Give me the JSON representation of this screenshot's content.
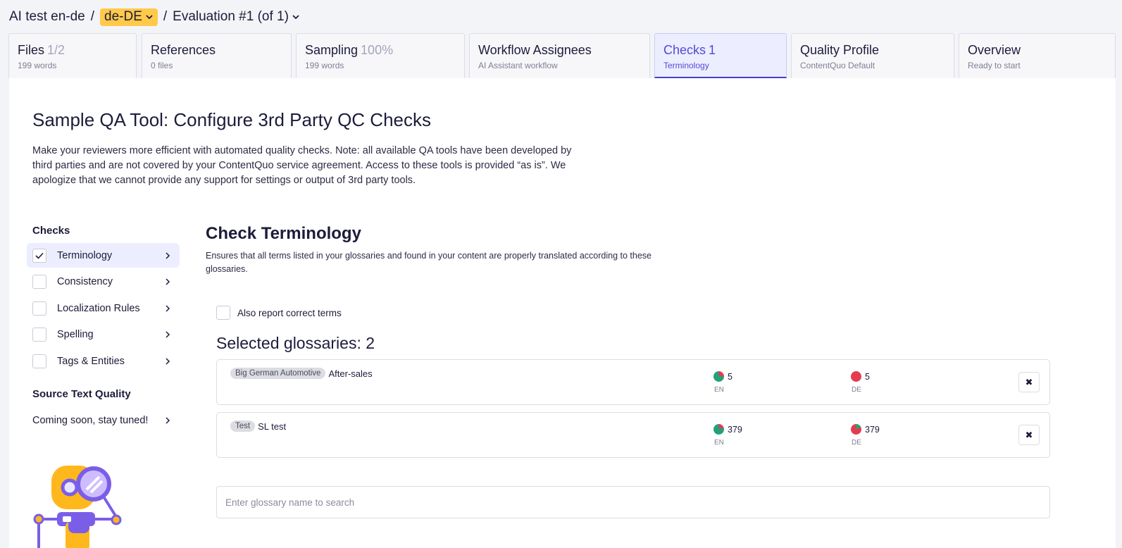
{
  "breadcrumb": {
    "project": "AI test en-de",
    "separator": "/",
    "language": "de-DE",
    "evaluation": "Evaluation #1 (of 1)"
  },
  "tabs": [
    {
      "title": "Files",
      "extra": "1/2",
      "sub": "199 words"
    },
    {
      "title": "References",
      "extra": "",
      "sub": "0 files"
    },
    {
      "title": "Sampling",
      "extra": "100%",
      "sub": "199 words"
    },
    {
      "title": "Workflow Assignees",
      "extra": "",
      "sub": "AI Assistant workflow"
    },
    {
      "title": "Checks",
      "extra": "1",
      "sub": "Terminology",
      "active": true
    },
    {
      "title": "Quality Profile",
      "extra": "",
      "sub": "ContentQuo Default"
    },
    {
      "title": "Overview",
      "extra": "",
      "sub": "Ready to start"
    }
  ],
  "page": {
    "title": "Sample QA Tool: Configure 3rd Party QC Checks",
    "description": "Make your reviewers more efficient with automated quality checks. Note: all available QA tools have been developed by third parties and are not covered by your ContentQuo service agreement. Access to these tools is provided “as is”. We apologize that we cannot provide any support for settings or output of 3rd party tools."
  },
  "checks": {
    "heading": "Checks",
    "items": [
      {
        "label": "Terminology",
        "checked": true
      },
      {
        "label": "Consistency",
        "checked": false
      },
      {
        "label": "Localization Rules",
        "checked": false
      },
      {
        "label": "Spelling",
        "checked": false
      },
      {
        "label": "Tags & Entities",
        "checked": false
      }
    ]
  },
  "source_quality": {
    "heading": "Source Text Quality",
    "item": "Coming soon, stay tuned!"
  },
  "terminology": {
    "title": "Check Terminology",
    "description": "Ensures that all terms listed in your glossaries and found in your content are properly translated according to these glossaries.",
    "also_report_label": "Also report correct terms",
    "selected_heading": "Selected glossaries: 2",
    "glossaries": [
      {
        "badge": "Big German Automotive",
        "name": "After-sales",
        "en_count": "5",
        "en_code": "EN",
        "de_count": "5",
        "de_code": "DE",
        "remove": "✖"
      },
      {
        "badge": "Test",
        "name": "SL test",
        "en_count": "379",
        "en_code": "EN",
        "de_count": "379",
        "de_code": "DE",
        "remove": "✖"
      }
    ],
    "search_placeholder": "Enter glossary name to search"
  },
  "colors": {
    "accent": "#5548d4",
    "highlight": "#ffc94a",
    "pie_green": "#1fa37a",
    "pie_red": "#e23d4f"
  },
  "icons": [
    "chevron-down-icon",
    "chevron-right-icon",
    "checkmark-icon",
    "close-icon",
    "robot-illustration"
  ]
}
